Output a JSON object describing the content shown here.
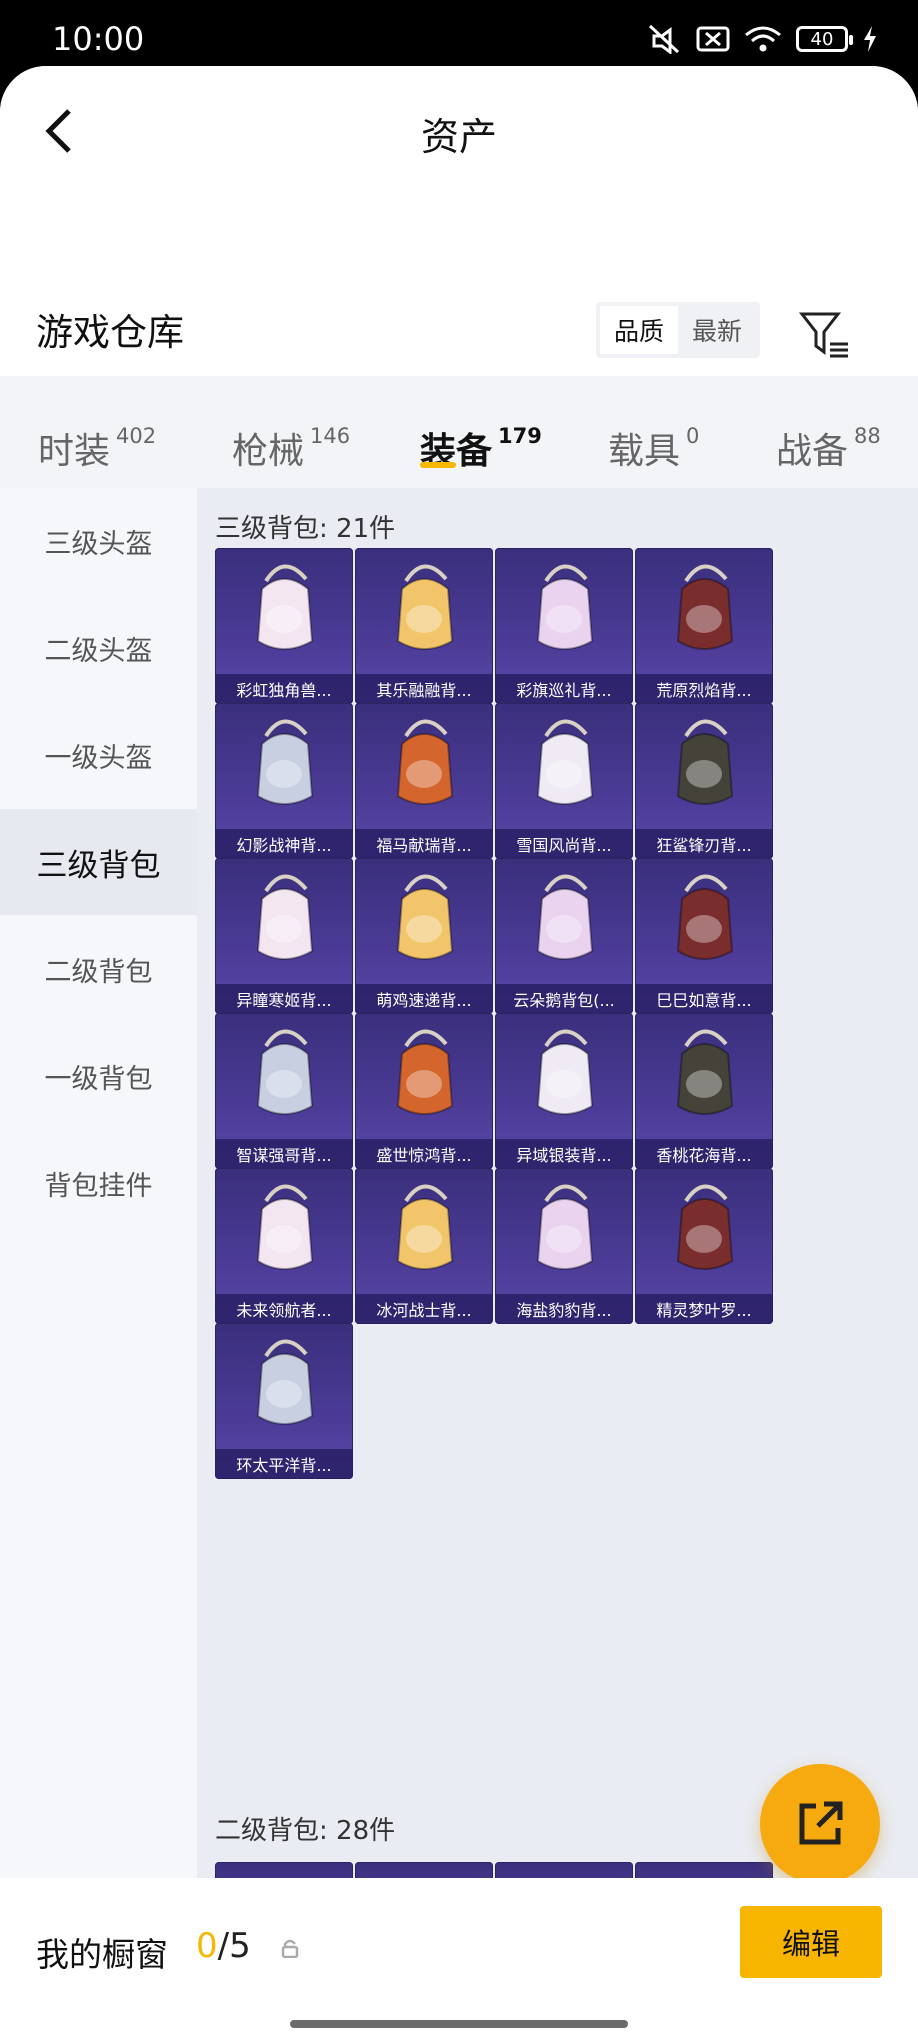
{
  "status_bar": {
    "time": "10:00",
    "battery": "40"
  },
  "header": {
    "title": "资产"
  },
  "warehouse": {
    "title": "游戏仓库",
    "sort_options": [
      "品质",
      "最新"
    ]
  },
  "tabs": [
    {
      "label": "时装",
      "count": "402"
    },
    {
      "label": "枪械",
      "count": "146"
    },
    {
      "label": "装备",
      "count": "179"
    },
    {
      "label": "载具",
      "count": "0"
    },
    {
      "label": "战备",
      "count": "88"
    }
  ],
  "sidebar": {
    "items": [
      "三级头盔",
      "二级头盔",
      "一级头盔",
      "三级背包",
      "二级背包",
      "一级背包",
      "背包挂件"
    ]
  },
  "groups": [
    {
      "title": "三级背包: 21件",
      "items": [
        "彩虹独角兽...",
        "其乐融融背...",
        "彩旗巡礼背...",
        "荒原烈焰背...",
        "幻影战神背...",
        "福马献瑞背...",
        "雪国风尚背...",
        "狂鲨锋刃背...",
        "异瞳寒姬背...",
        "萌鸡速递背...",
        "云朵鹅背包(...",
        "巳巳如意背...",
        "智谋强哥背...",
        "盛世惊鸿背...",
        "异域银装背...",
        "香桃花海背...",
        "未来领航者...",
        "冰河战士背...",
        "海盐豹豹背...",
        "精灵梦叶罗...",
        "环太平洋背..."
      ]
    },
    {
      "title": "二级背包: 28件",
      "items": [
        "",
        "",
        "",
        ""
      ]
    }
  ],
  "showcase": {
    "label": "我的橱窗",
    "current": "0",
    "total": "/5"
  },
  "edit_label": "编辑",
  "colors": {
    "accent": "#f6b800",
    "card_bg": "#3a2f7c",
    "fab": "#f7aa10"
  }
}
